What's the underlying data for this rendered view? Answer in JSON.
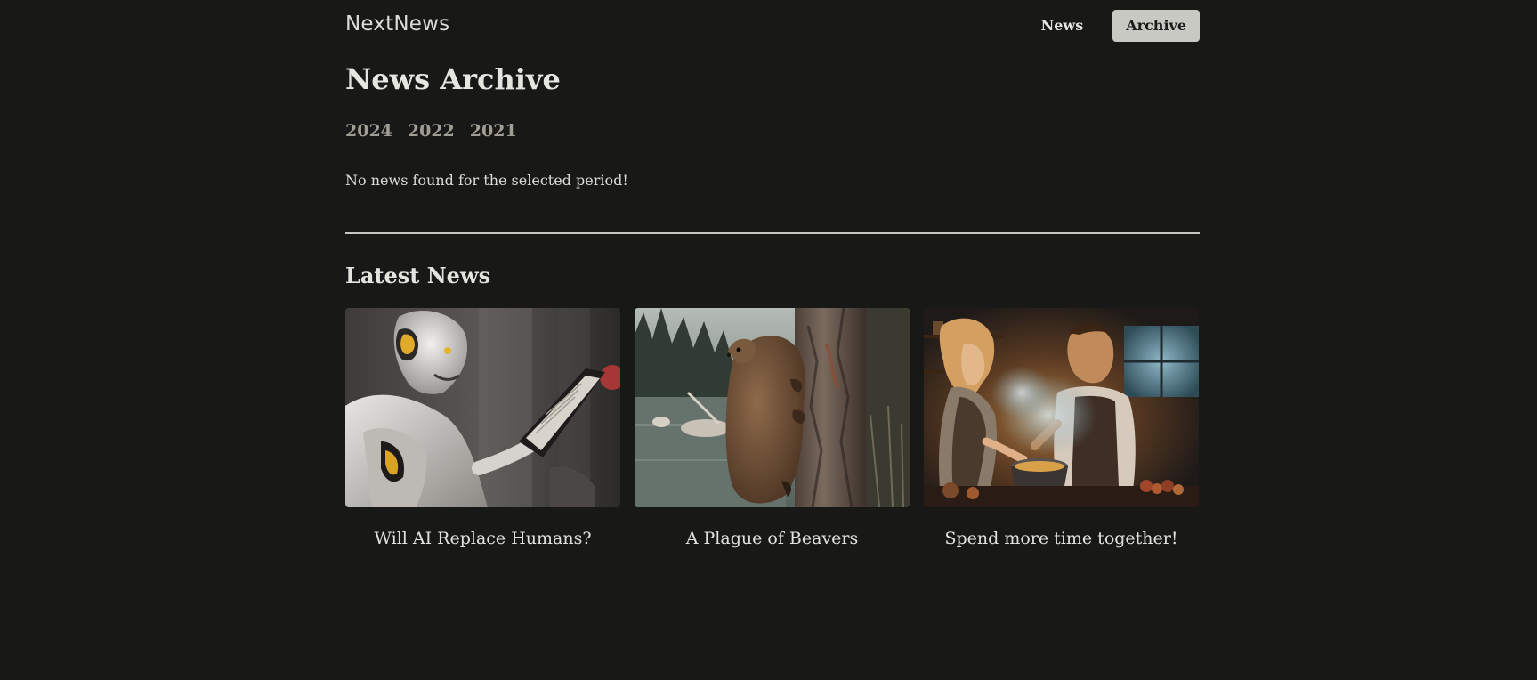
{
  "header": {
    "brand": "NextNews",
    "nav": {
      "news_label": "News",
      "archive_label": "Archive"
    }
  },
  "main": {
    "title": "News Archive",
    "years": [
      "2024",
      "2022",
      "2021"
    ],
    "empty_message": "No news found for the selected period!"
  },
  "latest": {
    "title": "Latest News",
    "items": [
      {
        "title": "Will AI Replace Humans?",
        "image": "robot reading a tablet"
      },
      {
        "title": "A Plague of Beavers",
        "image": "beaver climbing a tree by a lake"
      },
      {
        "title": "Spend more time together!",
        "image": "couple cooking in a kitchen"
      }
    ]
  },
  "colors": {
    "background": "#181817",
    "active_nav_bg": "#c9c9c3",
    "year_link": "#9f9d94",
    "divider": "#c6c6c0"
  }
}
